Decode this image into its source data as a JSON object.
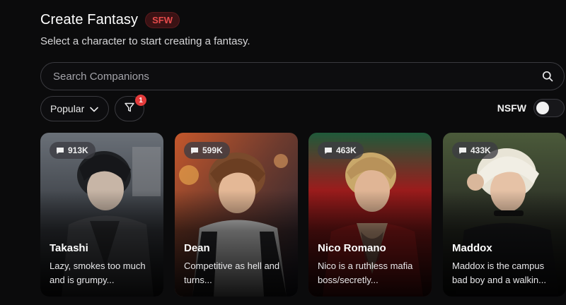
{
  "header": {
    "title": "Create Fantasy",
    "badge": "SFW",
    "subtitle": "Select a character to start creating a fantasy."
  },
  "search": {
    "placeholder": "Search Companions",
    "icon": "search-icon"
  },
  "controls": {
    "sort_label": "Popular",
    "filter_count": "1",
    "nsfw_label": "NSFW",
    "nsfw_enabled": false
  },
  "colors": {
    "background": "#0b0b0c",
    "accent": "#e33b3b",
    "badge_text": "#e64b4b"
  },
  "characters": [
    {
      "name": "Takashi",
      "chats": "913K",
      "desc": "Lazy, smokes too much and is grumpy..."
    },
    {
      "name": "Dean",
      "chats": "599K",
      "desc": "Competitive as hell and turns..."
    },
    {
      "name": "Nico Romano",
      "chats": "463K",
      "desc": "Nico is a ruthless mafia boss/secretly..."
    },
    {
      "name": "Maddox",
      "chats": "433K",
      "desc": "Maddox is the campus bad boy and a walkin..."
    }
  ]
}
